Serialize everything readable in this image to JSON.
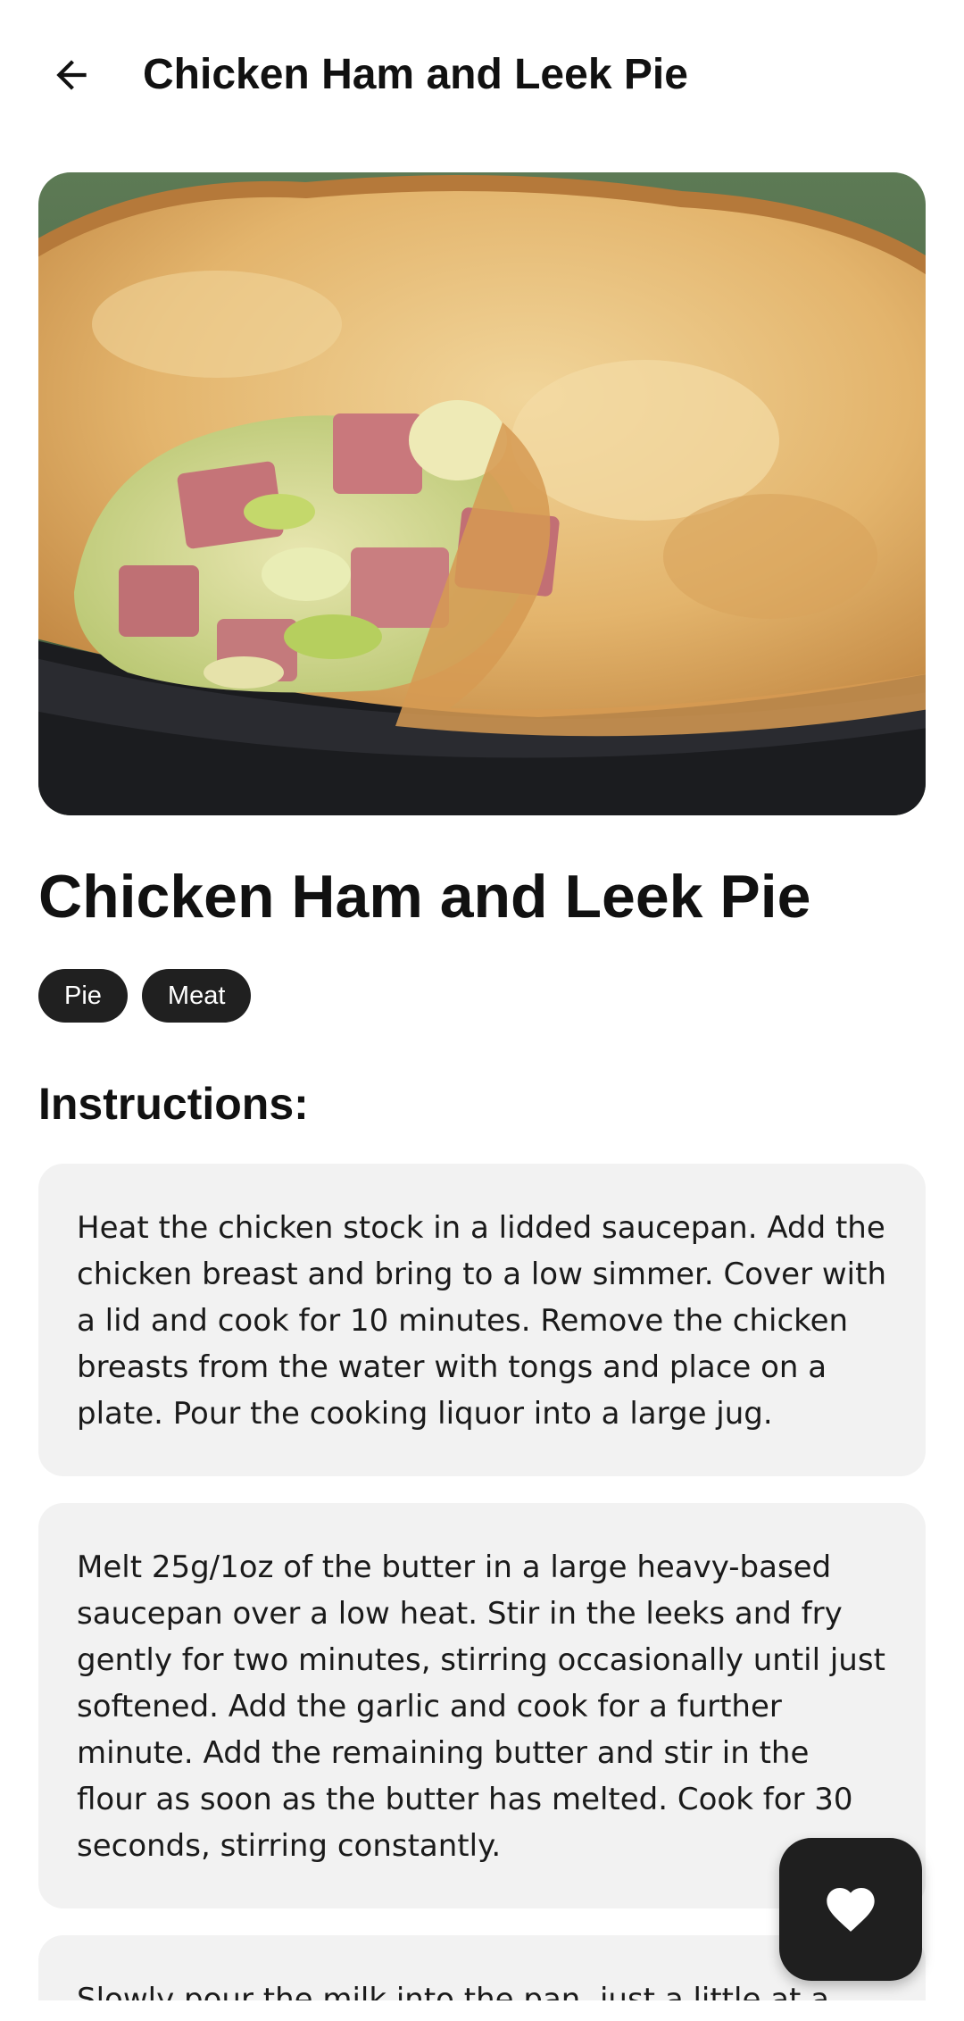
{
  "app_bar": {
    "title": "Chicken Ham and Leek Pie",
    "back_icon": "arrow-left-icon"
  },
  "recipe": {
    "title": "Chicken Ham and Leek Pie",
    "image": "chicken-ham-leek-pie-photo",
    "tags": [
      "Pie",
      "Meat"
    ]
  },
  "instructions": {
    "heading": "Instructions:",
    "steps": [
      "Heat the chicken stock in a lidded saucepan. Add the chicken breast and bring to a low simmer. Cover with a lid and cook for 10 minutes. Remove the chicken breasts from the water with tongs and place on a plate. Pour the cooking liquor into a large jug.",
      "Melt 25g/1oz of the butter in a large heavy-based saucepan over a low heat. Stir in the leeks and fry gently for two minutes, stirring occasionally until just softened. Add the garlic and cook for a further minute. Add the remaining butter and stir in the flour as soon as the butter has melted. Cook for 30 seconds, stirring constantly.",
      "Slowly pour the milk into the pan, just a little at a"
    ]
  },
  "fab": {
    "icon": "heart-icon",
    "background": "#1f1f1f",
    "icon_color": "#ffffff"
  }
}
